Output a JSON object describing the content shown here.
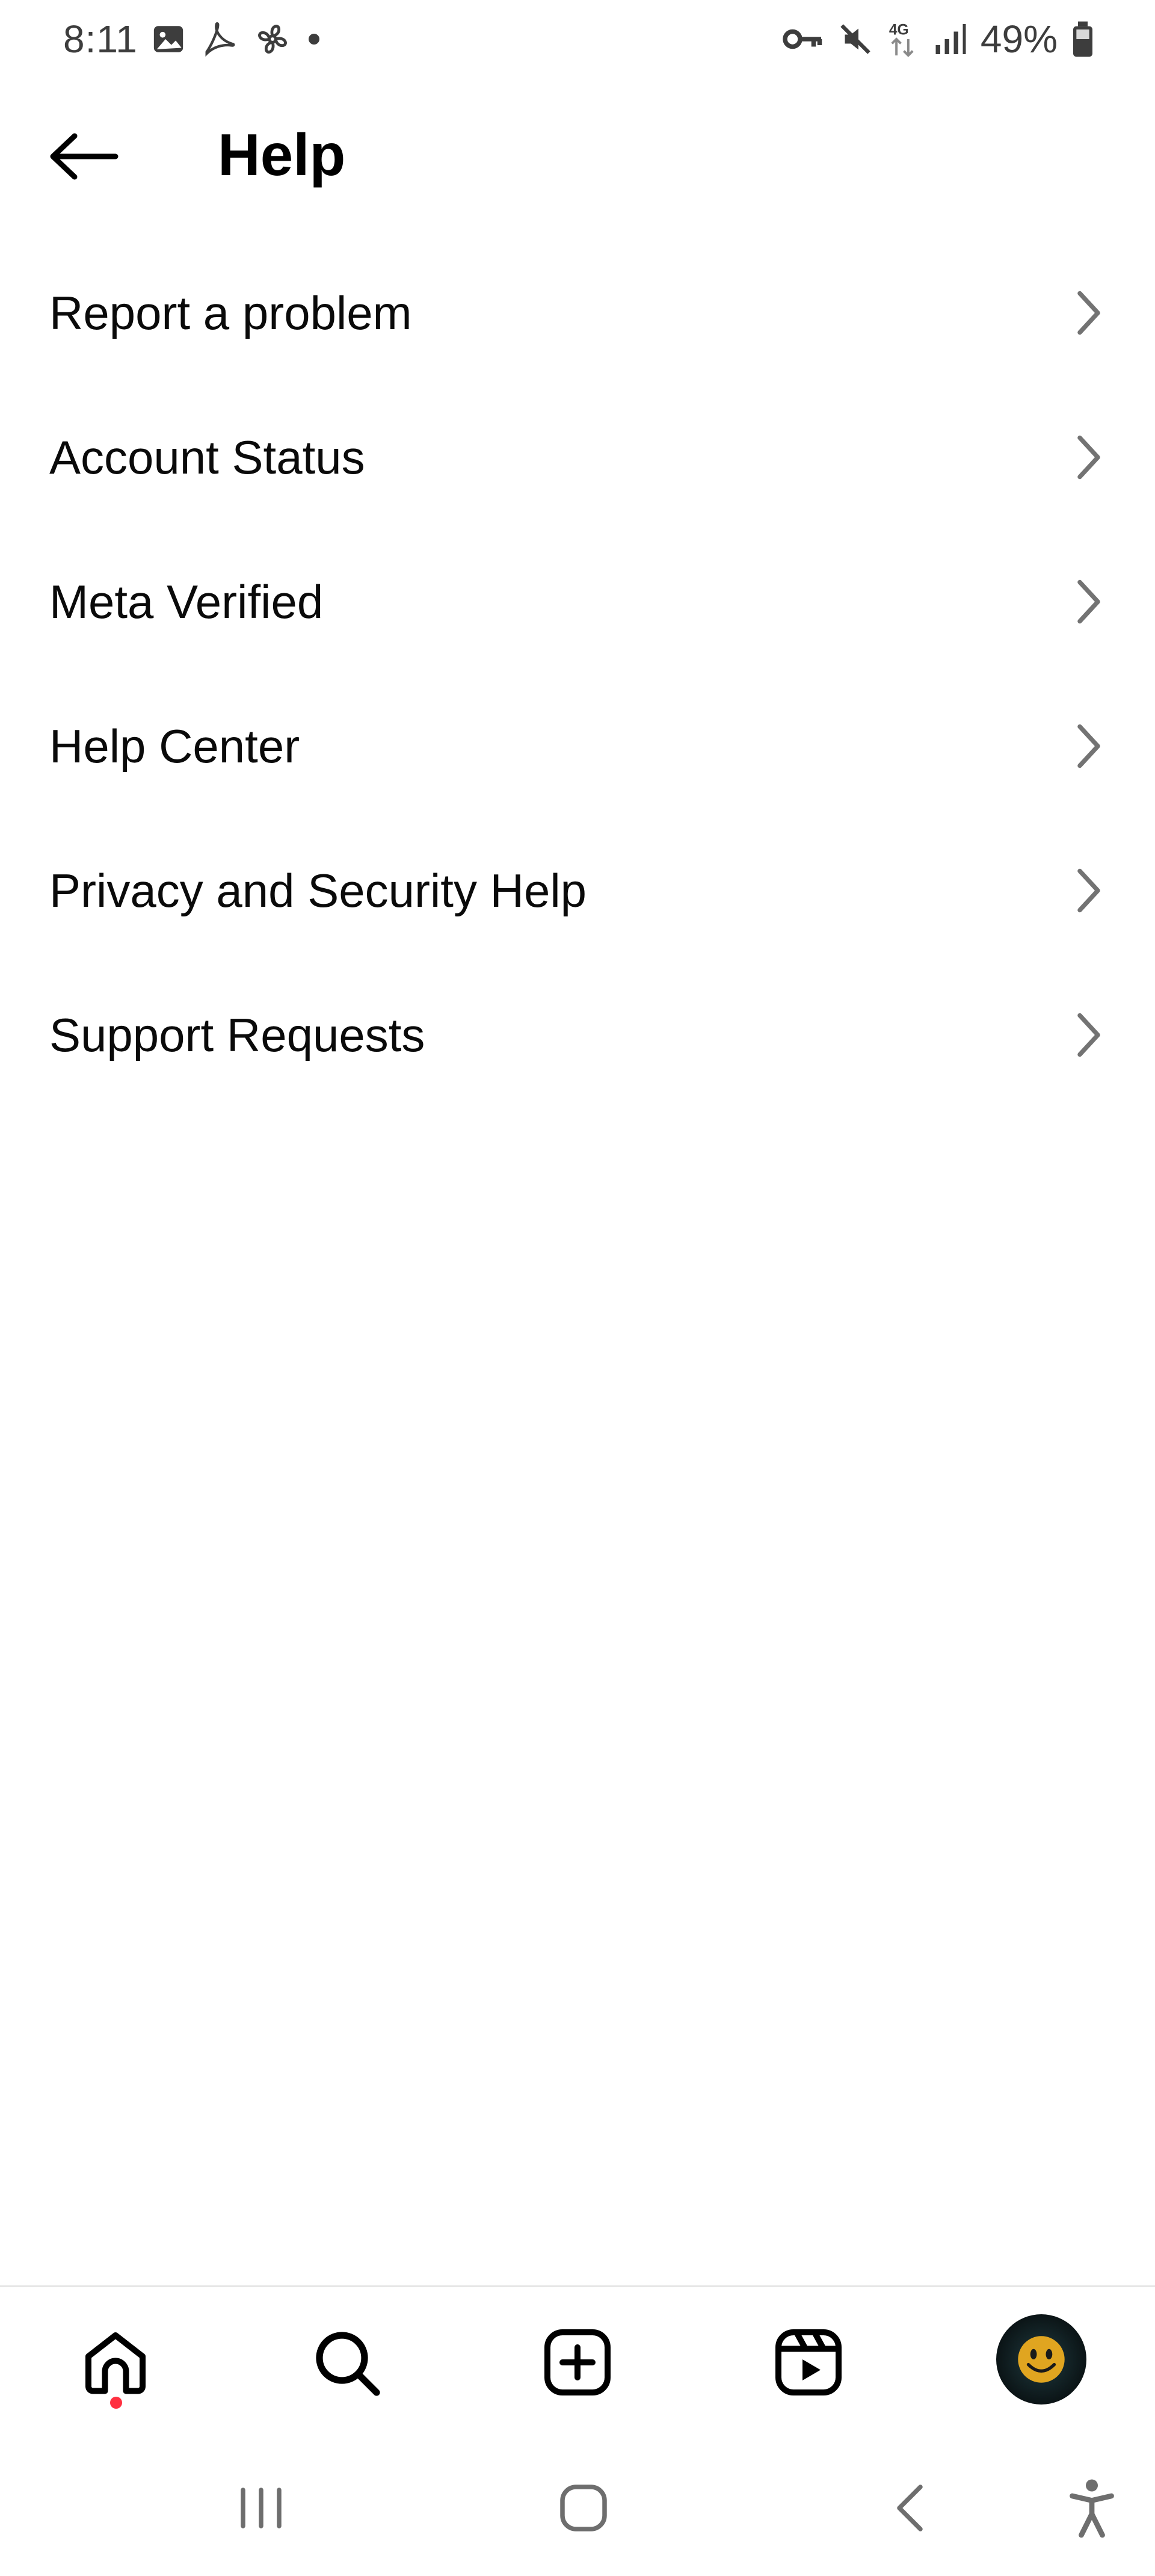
{
  "status_bar": {
    "time": "8:11",
    "battery": "49%",
    "network": "4G",
    "left_icons": [
      "gallery-icon",
      "pdf-icon",
      "fan-icon",
      "dot-icon"
    ],
    "right_icons": [
      "key-icon",
      "mute-icon",
      "network-4g-icon",
      "signal-icon",
      "battery-icon"
    ]
  },
  "header": {
    "back_icon": "arrow-left-icon",
    "title": "Help"
  },
  "menu": {
    "items": [
      {
        "label": "Report a problem"
      },
      {
        "label": "Account Status"
      },
      {
        "label": "Meta Verified"
      },
      {
        "label": "Help Center"
      },
      {
        "label": "Privacy and Security Help"
      },
      {
        "label": "Support Requests"
      }
    ],
    "chevron_icon": "chevron-right-icon"
  },
  "tab_bar": {
    "tabs": [
      "home-icon",
      "search-icon",
      "create-icon",
      "reels-icon",
      "profile-avatar"
    ],
    "notification_color": "#ff3040"
  },
  "system_nav": [
    "recents-icon",
    "home-icon",
    "back-icon",
    "accessibility-icon"
  ]
}
